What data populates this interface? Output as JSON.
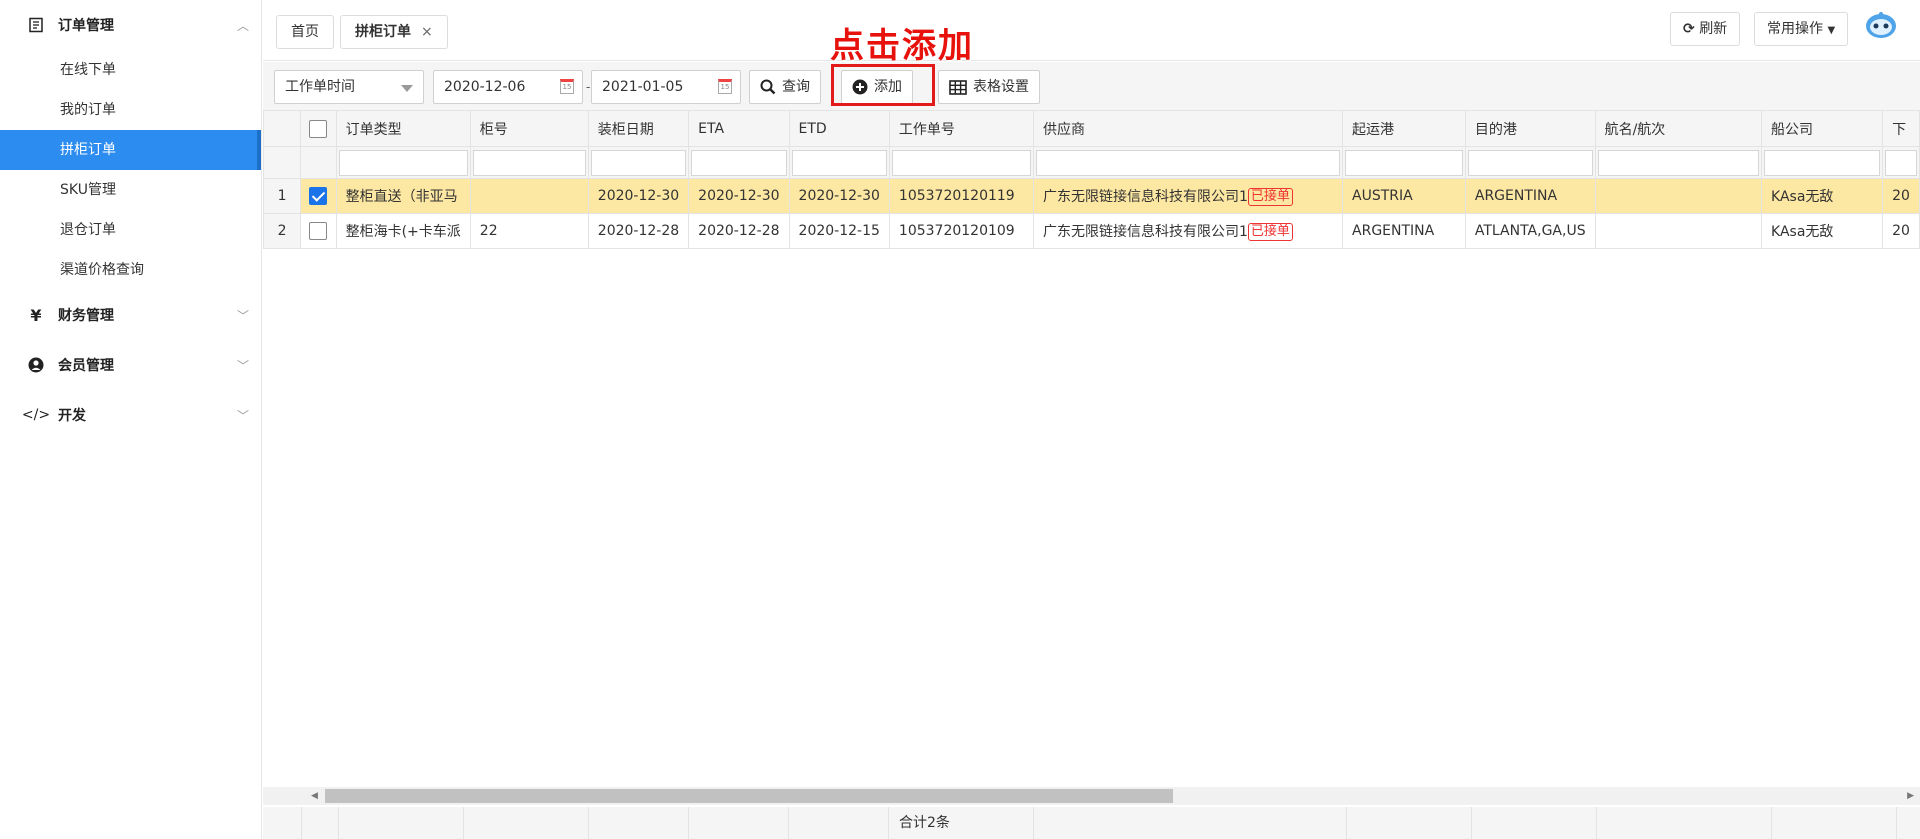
{
  "sidebar": {
    "groups": [
      {
        "label": "订单管理",
        "icon": "list-icon",
        "expanded": true,
        "items": [
          {
            "label": "在线下单"
          },
          {
            "label": "我的订单"
          },
          {
            "label": "拼柜订单",
            "active": true
          },
          {
            "label": "SKU管理"
          },
          {
            "label": "退仓订单"
          },
          {
            "label": "渠道价格查询"
          }
        ]
      },
      {
        "label": "财务管理",
        "icon": "yen-icon",
        "expanded": false
      },
      {
        "label": "会员管理",
        "icon": "user-icon",
        "expanded": false
      },
      {
        "label": "开发",
        "icon": "code-icon",
        "expanded": false
      }
    ]
  },
  "tabs": [
    {
      "label": "首页"
    },
    {
      "label": "拼柜订单",
      "active": true,
      "closable": true
    }
  ],
  "top_actions": {
    "refresh": "刷新",
    "common_ops": "常用操作"
  },
  "annotation": "点击添加",
  "filters": {
    "date_type": "工作单时间",
    "date_from": "2020-12-06",
    "date_to": "2021-01-05",
    "separator": "-",
    "query": "查询",
    "add": "添加",
    "table_settings": "表格设置"
  },
  "table": {
    "columns": [
      "订单类型",
      "柜号",
      "装柜日期",
      "ETA",
      "ETD",
      "工作单号",
      "供应商",
      "起运港",
      "目的港",
      "航名/航次",
      "船公司",
      "下"
    ],
    "rows": [
      {
        "index": "1",
        "checked": true,
        "order_type": "整柜直送（非亚马",
        "container": "",
        "load_date": "2020-12-30",
        "eta": "2020-12-30",
        "etd": "2020-12-30",
        "work_no": "1053720120119",
        "supplier": "广东无限链接信息科技有限公司1",
        "status": "已接单",
        "from_port": "AUSTRIA",
        "to_port": "ARGENTINA",
        "voyage": "",
        "carrier": "KAsa无敌",
        "extra": "20"
      },
      {
        "index": "2",
        "checked": false,
        "order_type": "整柜海卡(+卡车派",
        "container": "22",
        "load_date": "2020-12-28",
        "eta": "2020-12-28",
        "etd": "2020-12-15",
        "work_no": "1053720120109",
        "supplier": "广东无限链接信息科技有限公司1",
        "status": "已接单",
        "from_port": "ARGENTINA",
        "to_port": "ATLANTA,GA,US",
        "voyage": "",
        "carrier": "KAsa无敌",
        "extra": "20"
      }
    ],
    "footer_total": "合计2条"
  },
  "colors": {
    "accent": "#2d8cf0",
    "annotation": "#e8120c",
    "selected_row": "#fde8a3"
  }
}
